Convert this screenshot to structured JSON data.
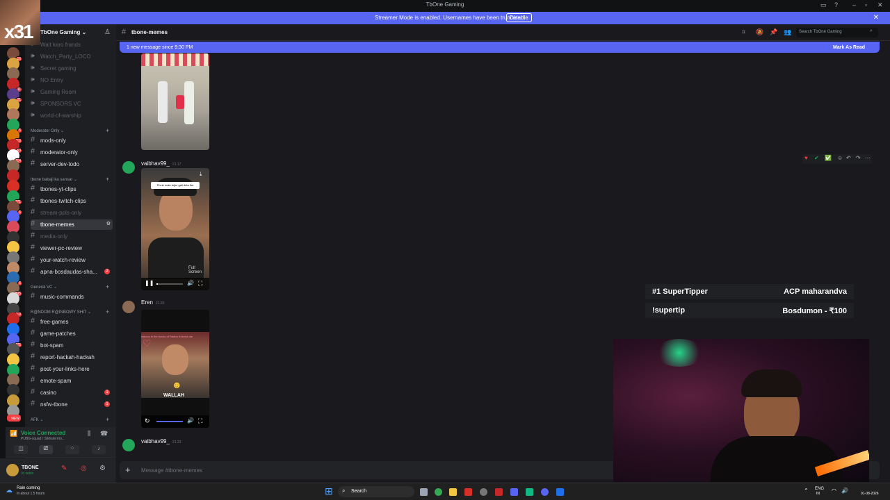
{
  "window": {
    "title": "TbOne Gaming"
  },
  "streamer_banner": {
    "text": "Streamer Mode is enabled. Usernames have been truncated.",
    "button": "Disable"
  },
  "overlay_counter": "x31",
  "server": {
    "name": "TbOne Gaming"
  },
  "server_badges": [
    "16",
    "",
    "",
    "11",
    "21",
    "",
    "",
    "5",
    "110",
    "63",
    "114",
    "",
    "",
    "",
    "271",
    "5",
    "",
    "",
    "",
    "",
    "",
    "",
    "6",
    "895",
    "",
    "419",
    "",
    "",
    "475",
    "",
    "",
    "",
    "",
    "",
    "",
    "",
    "NEW"
  ],
  "sidebar": {
    "top_channels": [
      {
        "label": "Wait karo frands"
      },
      {
        "label": "Watch_Party_LOCO"
      },
      {
        "label": "Secret gaming"
      },
      {
        "label": "NO Entry"
      },
      {
        "label": "Gaming Room"
      },
      {
        "label": "SPONSORS VC"
      },
      {
        "label": "world-of-warship"
      }
    ],
    "categories": [
      {
        "label": "Moderator Only",
        "channels": [
          {
            "label": "mods-only"
          },
          {
            "label": "moderator-only"
          },
          {
            "label": "server-dev-todo"
          }
        ]
      },
      {
        "label": "tbone babaji ka sansar",
        "channels": [
          {
            "label": "tbones-yt-clips"
          },
          {
            "label": "tbones-twitch-clips"
          },
          {
            "label": "stream-ppls-only"
          },
          {
            "label": "tbone-memes"
          },
          {
            "label": "media-only"
          },
          {
            "label": "viewer-pc-review"
          },
          {
            "label": "your-watch-review"
          },
          {
            "label": "apna-bosdaudas-sha...",
            "badge": "2"
          }
        ]
      },
      {
        "label": "General VC",
        "channels": [
          {
            "label": "music-commands"
          }
        ]
      },
      {
        "label": "R@NDOM R@INBOWY SHIT",
        "channels": [
          {
            "label": "free-games"
          },
          {
            "label": "game-patches"
          },
          {
            "label": "bot-spam"
          },
          {
            "label": "report-hackah-hackah"
          },
          {
            "label": "post-your-links-here"
          },
          {
            "label": "emote-spam"
          },
          {
            "label": "casino",
            "badge": "1"
          },
          {
            "label": "nsfw-tbone",
            "badge": "1"
          }
        ]
      },
      {
        "label": "AFK",
        "channels": []
      }
    ]
  },
  "voice": {
    "status": "Voice Connected",
    "channel": "PUBG-squad / Sikhsterrrio..."
  },
  "user": {
    "name": "TBONE",
    "status": "In voice"
  },
  "header": {
    "channel": "tbone-memes",
    "search_placeholder": "Search TbOne Gaming"
  },
  "new_message_bar": {
    "text": "1 new message since 9:30 PM",
    "action": "Mark As Read"
  },
  "messages": [
    {
      "author": "vaibhav99_",
      "time": "21:17",
      "caption": "Phele main tujhe gali deta tha",
      "tooltip": "Full Screen"
    },
    {
      "author": "Eren",
      "time": "21:20",
      "caption": "estions in the books of Radha Krishna dar",
      "watermark": "WALLAH"
    },
    {
      "author": "vaibhav99_",
      "time": "21:23"
    }
  ],
  "composer": {
    "placeholder": "Message #tbone-memes"
  },
  "tips": [
    {
      "left": "#1 SuperTipper",
      "right": "ACP maharandva"
    },
    {
      "left": "!supertip",
      "right": "Bosdumon - ₹100"
    }
  ],
  "taskbar": {
    "weather_title": "Rain coming",
    "weather_sub": "In about 1.5 hours",
    "search": "Search",
    "lang": "ENG",
    "region": "IN",
    "date": "01-08-2026"
  },
  "colors": {
    "accent": "#5865f2",
    "danger": "#f23f43",
    "online": "#23a55a"
  }
}
